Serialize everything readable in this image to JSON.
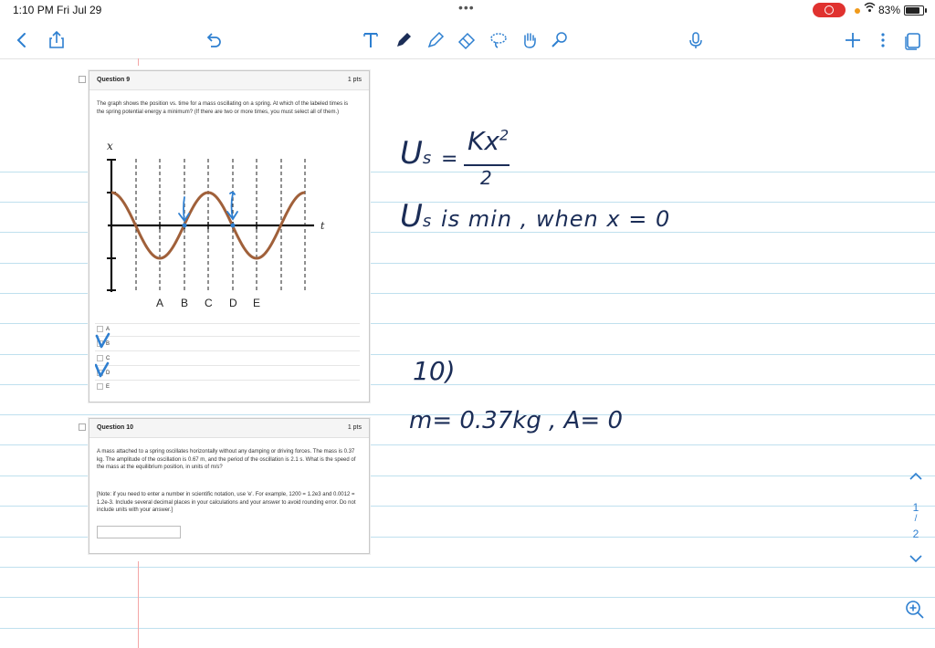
{
  "status_bar": {
    "time": "1:10 PM",
    "date": "Fri Jul 29",
    "dots": "•••",
    "battery": "83%"
  },
  "toolbar": {
    "icons": [
      "back-icon",
      "share-icon",
      "undo-icon",
      "text-tool-icon",
      "pen-icon",
      "highlighter-icon",
      "eraser-icon",
      "lasso-icon",
      "hand-icon",
      "shape-icon",
      "microphone-icon",
      "add-icon",
      "more-icon",
      "pages-icon"
    ]
  },
  "question9": {
    "title": "Question 9",
    "points": "1 pts",
    "text": "The graph shows the position vs. time for a mass oscillating on a spring.  At which of the labeled times is the spring potential energy a minimum?  (If there are two or more times, you must select all of them.)",
    "graph": {
      "y_label": "x",
      "x_label": "t",
      "tick_labels": [
        "A",
        "B",
        "C",
        "D",
        "E"
      ]
    },
    "options": [
      "A",
      "B",
      "C",
      "D",
      "E"
    ]
  },
  "question10": {
    "title": "Question 10",
    "points": "1 pts",
    "text": "A mass attached to a spring oscillates horizontally without any damping or driving forces. The mass is 0.37 kg.  The amplitude of the oscillation is 0.67 m, and the period of the oscillation is 2.1 s.  What is the speed of the mass at the equilibrium position, in units of m/s?",
    "note": "[Note: if you need to enter a number in scientific notation, use 'e'.  For example, 1200 = 1.2e3 and 0.0012 = 1.2e-3.  Include several decimal places in your calculations and your answer to avoid rounding error.  Do not include units with your answer.]"
  },
  "handwriting": {
    "eq_left": "U",
    "eq_sub": "s",
    "eq_equals": "=",
    "eq_num": "Kx",
    "eq_exp": "2",
    "eq_den": "2",
    "line2": "U",
    "line2_sub": "s",
    "line2_rest": "is min , when x = 0",
    "q10_label": "10)",
    "q10_line": "m= 0.37kg ,  A= 0"
  },
  "page_nav": {
    "current": "1",
    "separator": "/",
    "total": "2"
  },
  "colors": {
    "ink": "#1b2d57",
    "check": "#2f7fd0",
    "wave": "#a0603a",
    "rule": "#bfe0ee",
    "accent": "#2d7fd0"
  }
}
